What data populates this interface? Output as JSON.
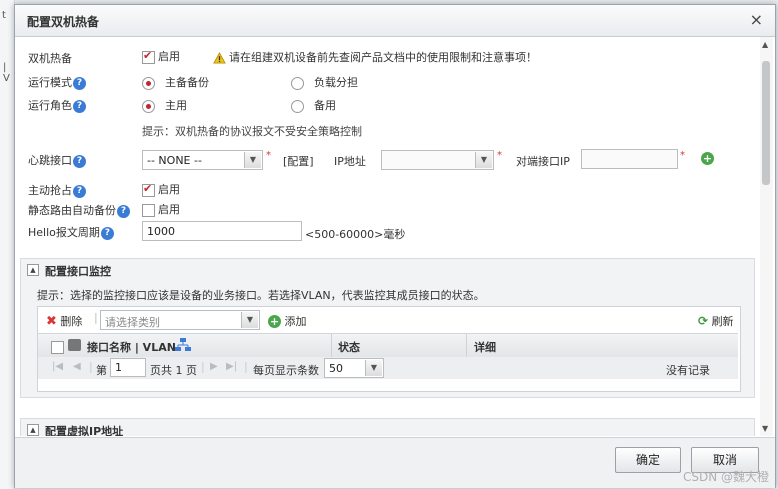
{
  "background": {
    "edge_top": "t",
    "edge_mid": "| V"
  },
  "dialog": {
    "title": "配置双机热备"
  },
  "form": {
    "hot_standby": {
      "label": "双机热备",
      "checkbox": "启用",
      "warning": "请在组建双机设备前先查阅产品文档中的使用限制和注意事项！"
    },
    "run_mode": {
      "label": "运行模式",
      "opt1": "主备备份",
      "opt2": "负载分担"
    },
    "run_role": {
      "label": "运行角色",
      "opt1": "主用",
      "opt2": "备用"
    },
    "hint": "提示：双机热备的协议报文不受安全策略控制",
    "heartbeat": {
      "label": "心跳接口",
      "value": "-- NONE --",
      "config_link": "[配置]",
      "ip_label": "IP地址",
      "peer_label": "对端接口IP"
    },
    "preempt": {
      "label": "主动抢占",
      "checkbox": "启用"
    },
    "static_route": {
      "label": "静态路由自动备份",
      "checkbox": "启用"
    },
    "hello": {
      "label": "Hello报文周期",
      "value": "1000",
      "range": "<500-60000>毫秒"
    }
  },
  "monitor": {
    "title": "配置接口监控",
    "hint": "提示：选择的监控接口应该是设备的业务接口。若选择VLAN，代表监控其成员接口的状态。",
    "toolbar": {
      "delete": "删除",
      "category_placeholder": "请选择类别",
      "add": "添加",
      "refresh": "刷新"
    },
    "columns": {
      "name": "接口名称 | VLAN",
      "status": "状态",
      "detail": "详细"
    },
    "pager": {
      "page_prefix": "第",
      "page": "1",
      "page_total": "页共 1 页",
      "per_page_label": "每页显示条数",
      "per_page": "50",
      "empty": "没有记录"
    }
  },
  "vip": {
    "title": "配置虚拟IP地址"
  },
  "footer": {
    "ok": "确定",
    "cancel": "取消"
  },
  "watermark": "CSDN @魏大橙"
}
